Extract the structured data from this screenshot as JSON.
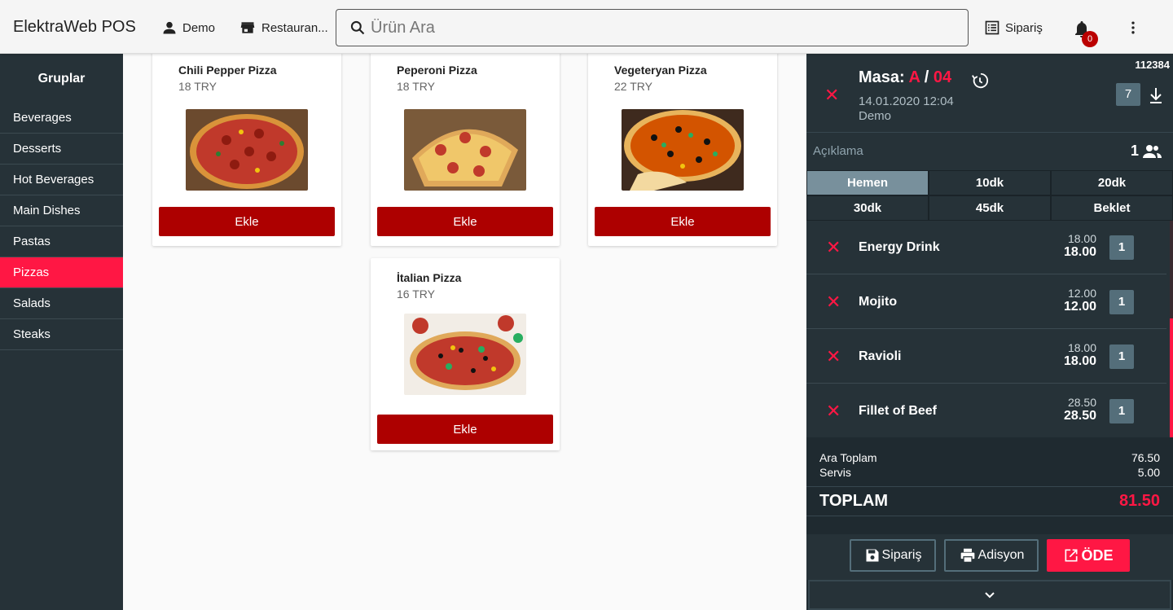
{
  "header": {
    "app_title": "ElektraWeb POS",
    "user": "Demo",
    "store": "Restauran...",
    "search_placeholder": "Ürün Ara",
    "order_label": "Sipariş",
    "notification_count": "0"
  },
  "sidebar": {
    "title": "Gruplar",
    "items": [
      {
        "label": "Beverages"
      },
      {
        "label": "Desserts"
      },
      {
        "label": "Hot Beverages"
      },
      {
        "label": "Main Dishes"
      },
      {
        "label": "Pastas"
      },
      {
        "label": "Pizzas",
        "active": true
      },
      {
        "label": "Salads"
      },
      {
        "label": "Steaks"
      }
    ]
  },
  "products": [
    {
      "name": "Chili Pepper Pizza",
      "price": "18 TRY",
      "button": "Ekle"
    },
    {
      "name": "Peperoni Pizza",
      "price": "18 TRY",
      "button": "Ekle"
    },
    {
      "name": "Vegeteryan Pizza",
      "price": "22 TRY",
      "button": "Ekle"
    },
    {
      "name": "İtalian Pizza",
      "price": "16 TRY",
      "button": "Ekle"
    }
  ],
  "order": {
    "id": "112384",
    "masa_label": "Masa:",
    "masa_section": "A",
    "masa_sep": "/",
    "masa_number": "04",
    "date": "14.01.2020 12:04",
    "user": "Demo",
    "count": "7",
    "aciklama": "Açıklama",
    "guests": "1",
    "timing": [
      "Hemen",
      "10dk",
      "20dk",
      "30dk",
      "45dk",
      "Beklet"
    ],
    "items": [
      {
        "name": "Energy Drink",
        "unit": "18.00",
        "total": "18.00",
        "qty": "1"
      },
      {
        "name": "Mojito",
        "unit": "12.00",
        "total": "12.00",
        "qty": "1"
      },
      {
        "name": "Ravioli",
        "unit": "18.00",
        "total": "18.00",
        "qty": "1"
      },
      {
        "name": "Fillet of Beef",
        "unit": "28.50",
        "total": "28.50",
        "qty": "1"
      }
    ],
    "subtotal_label": "Ara Toplam",
    "subtotal": "76.50",
    "service_label": "Servis",
    "service": "5.00",
    "total_label": "TOPLAM",
    "total": "81.50",
    "btn_order": "Sipariş",
    "btn_check": "Adisyon",
    "btn_pay": "ÖDE"
  },
  "colors": {
    "accent": "#ff1744",
    "add_button": "#ad0000",
    "dark_panel": "#263238"
  }
}
